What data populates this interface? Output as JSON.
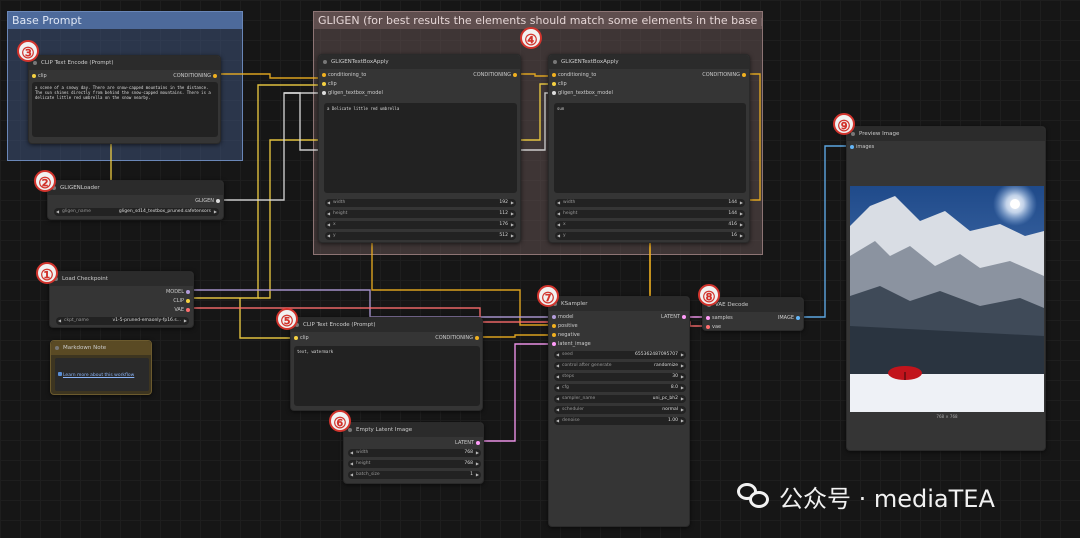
{
  "groups": {
    "base_prompt": {
      "title": "Base Prompt",
      "color": "#335"
    },
    "gligen": {
      "title": "GLIGEN (for best results the elements should match some elements in the base prompt)"
    }
  },
  "badges": [
    "③",
    "②",
    "①",
    "④",
    "⑤",
    "⑥",
    "⑦",
    "⑧",
    "⑨"
  ],
  "nodes": {
    "clip_text_encode_base": {
      "title": "CLIP Text Encode (Prompt)",
      "input_clip": "clip",
      "output": "CONDITIONING",
      "text": "a scene of a snowy day. There are snow-capped mountains in the distance. The sun shines directly from behind the snow-capped mountains. There is a delicate little red umbrella on the snow nearby."
    },
    "gligen_loader": {
      "title": "GLIGENLoader",
      "output": "GLIGEN",
      "widget_label": "gligen_name",
      "widget_value": "gligen_sd14_textbox_pruned.safetensors"
    },
    "load_checkpoint": {
      "title": "Load Checkpoint",
      "outputs": [
        "MODEL",
        "CLIP",
        "VAE"
      ],
      "widget_label": "ckpt_name",
      "widget_value": "v1-5-pruned-emaonly-fp16.s..."
    },
    "markdown_note": {
      "title": "Markdown Note",
      "link": "Learn more about this workflow"
    },
    "gligen_box_1": {
      "title": "GLIGENTextBoxApply",
      "inputs": [
        "conditioning_to",
        "clip",
        "gligen_textbox_model"
      ],
      "output": "CONDITIONING",
      "text": "a Delicate little red umbrella",
      "widgets": [
        {
          "label": "width",
          "value": "192"
        },
        {
          "label": "height",
          "value": "112"
        },
        {
          "label": "x",
          "value": "176"
        },
        {
          "label": "y",
          "value": "512"
        }
      ]
    },
    "gligen_box_2": {
      "title": "GLIGENTextBoxApply",
      "inputs": [
        "conditioning_to",
        "clip",
        "gligen_textbox_model"
      ],
      "output": "CONDITIONING",
      "text": "sun",
      "widgets": [
        {
          "label": "width",
          "value": "144"
        },
        {
          "label": "height",
          "value": "144"
        },
        {
          "label": "x",
          "value": "416"
        },
        {
          "label": "y",
          "value": "16"
        }
      ]
    },
    "clip_text_encode_neg": {
      "title": "CLIP Text Encode (Prompt)",
      "input_clip": "clip",
      "output": "CONDITIONING",
      "text": "text, watermark"
    },
    "empty_latent": {
      "title": "Empty Latent Image",
      "output": "LATENT",
      "widgets": [
        {
          "label": "width",
          "value": "768"
        },
        {
          "label": "height",
          "value": "768"
        },
        {
          "label": "batch_size",
          "value": "1"
        }
      ]
    },
    "ksampler": {
      "title": "KSampler",
      "inputs": [
        "model",
        "positive",
        "negative",
        "latent_image"
      ],
      "output": "LATENT",
      "widgets": [
        {
          "label": "seed",
          "value": "655362487095707"
        },
        {
          "label": "control after generate",
          "value": "randomize"
        },
        {
          "label": "steps",
          "value": "30"
        },
        {
          "label": "cfg",
          "value": "8.0"
        },
        {
          "label": "sampler_name",
          "value": "uni_pc_bh2"
        },
        {
          "label": "scheduler",
          "value": "normal"
        },
        {
          "label": "denoise",
          "value": "1.00"
        }
      ]
    },
    "vae_decode": {
      "title": "VAE Decode",
      "inputs": [
        "samples",
        "vae"
      ],
      "output": "IMAGE"
    },
    "preview_image": {
      "title": "Preview Image",
      "input": "images",
      "caption": "768 × 768"
    }
  },
  "watermark": "公众号 · mediaTEA",
  "colors": {
    "conditioning": "#f0b020",
    "clip": "#f5d142",
    "model": "#b39ddb",
    "vae": "#ff6e6e",
    "latent": "#ff9cf9",
    "image": "#64b5f6",
    "gligen": "#dddddd"
  }
}
